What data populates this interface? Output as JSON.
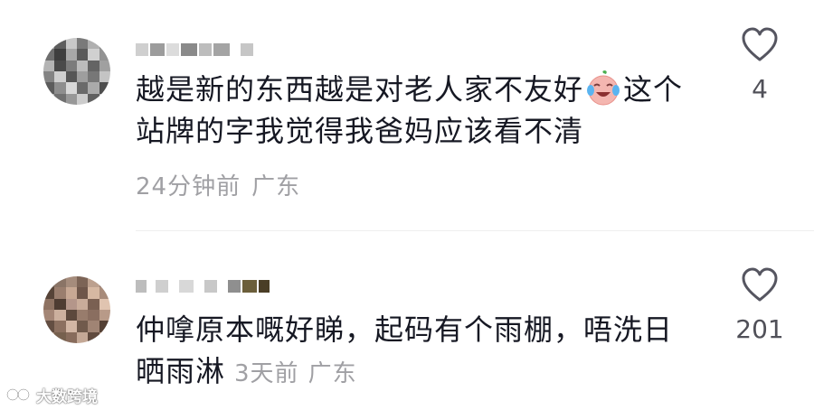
{
  "comments": [
    {
      "text_part1": "越是新的东西越是对老人家不友好",
      "emoji": "laughing-crying-face-icon",
      "text_part2": "这个站牌的字我觉得我爸妈应该看不清",
      "time": "24分钟前",
      "location": "广东",
      "likes": "4"
    },
    {
      "text": "仲嗱原本嘅好睇，起码有个雨棚，唔洗日晒雨淋",
      "time": "3天前",
      "location": "广东",
      "likes": "201"
    }
  ],
  "watermark": {
    "text": "大数跨境"
  },
  "colors": {
    "text": "#161823",
    "meta": "#a0a0a4",
    "like_count": "#505058",
    "divider": "#eeeeee"
  }
}
